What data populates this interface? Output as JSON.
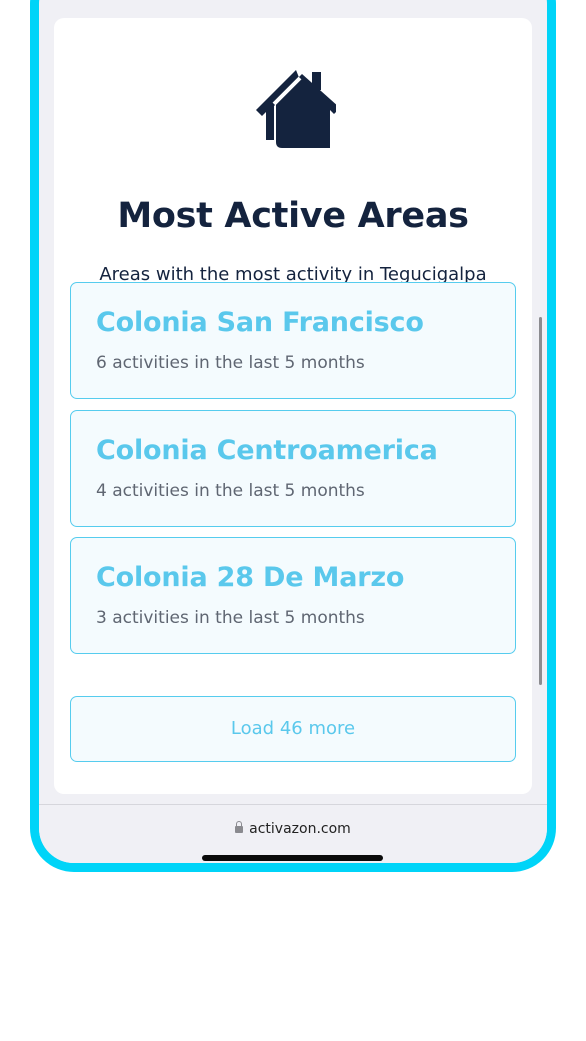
{
  "header": {
    "icon": "house-icon",
    "title": "Most Active Areas",
    "subtitle": "Areas with the most activity in Tegucigalpa"
  },
  "areas": [
    {
      "name": "Colonia San Francisco",
      "activity": "6 activities in the last 5 months"
    },
    {
      "name": "Colonia Centroamerica",
      "activity": "4 activities in the last 5 months"
    },
    {
      "name": "Colonia 28 De Marzo",
      "activity": "3 activities in the last 5 months"
    }
  ],
  "load_more_label": "Load 46 more",
  "browser": {
    "url": "activazon.com",
    "lock_icon": "lock-icon"
  },
  "colors": {
    "frame": "#00d4f8",
    "accent": "#5ac8ec",
    "title": "#14233e",
    "muted_text": "#5f6672"
  }
}
